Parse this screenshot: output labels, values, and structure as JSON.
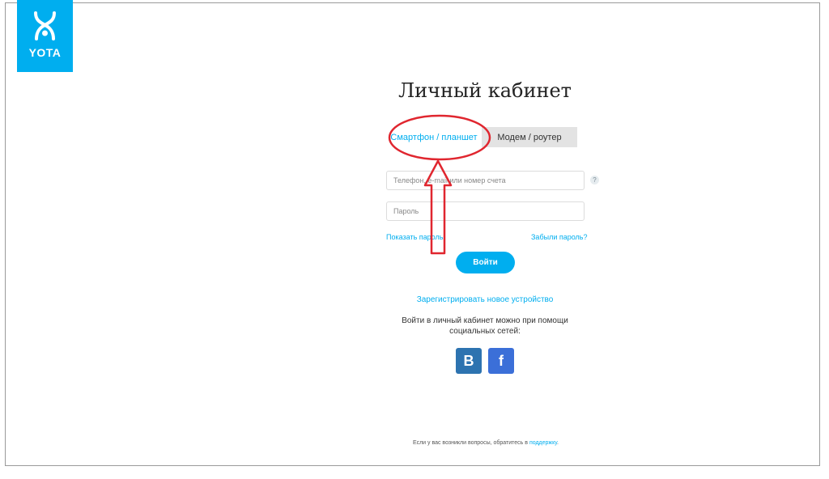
{
  "logo": {
    "text": "YOTA"
  },
  "page": {
    "title": "Личный кабинет"
  },
  "tabs": [
    {
      "label": "Смартфон / планшет",
      "active": true
    },
    {
      "label": "Модем / роутер",
      "active": false
    }
  ],
  "form": {
    "login_placeholder": "Телефон, e-mail или номер счета",
    "login_value": "",
    "help_symbol": "?",
    "password_placeholder": "Пароль",
    "password_value": "",
    "show_password": "Показать пароль",
    "forgot_password": "Забыли пароль?",
    "submit": "Войти"
  },
  "register_link": "Зарегистрировать новое устройство",
  "social": {
    "text": "Войти в личный кабинет можно при помощи социальных сетей:",
    "vk": "В",
    "fb": "f"
  },
  "footer": {
    "text": "Если у вас возникли вопросы, обратитесь в",
    "link": "поддержку",
    "dot": "."
  },
  "colors": {
    "accent": "#00aeef",
    "annotation": "#e0262f",
    "vk": "#2d73b0",
    "facebook": "#3b6fd8"
  }
}
